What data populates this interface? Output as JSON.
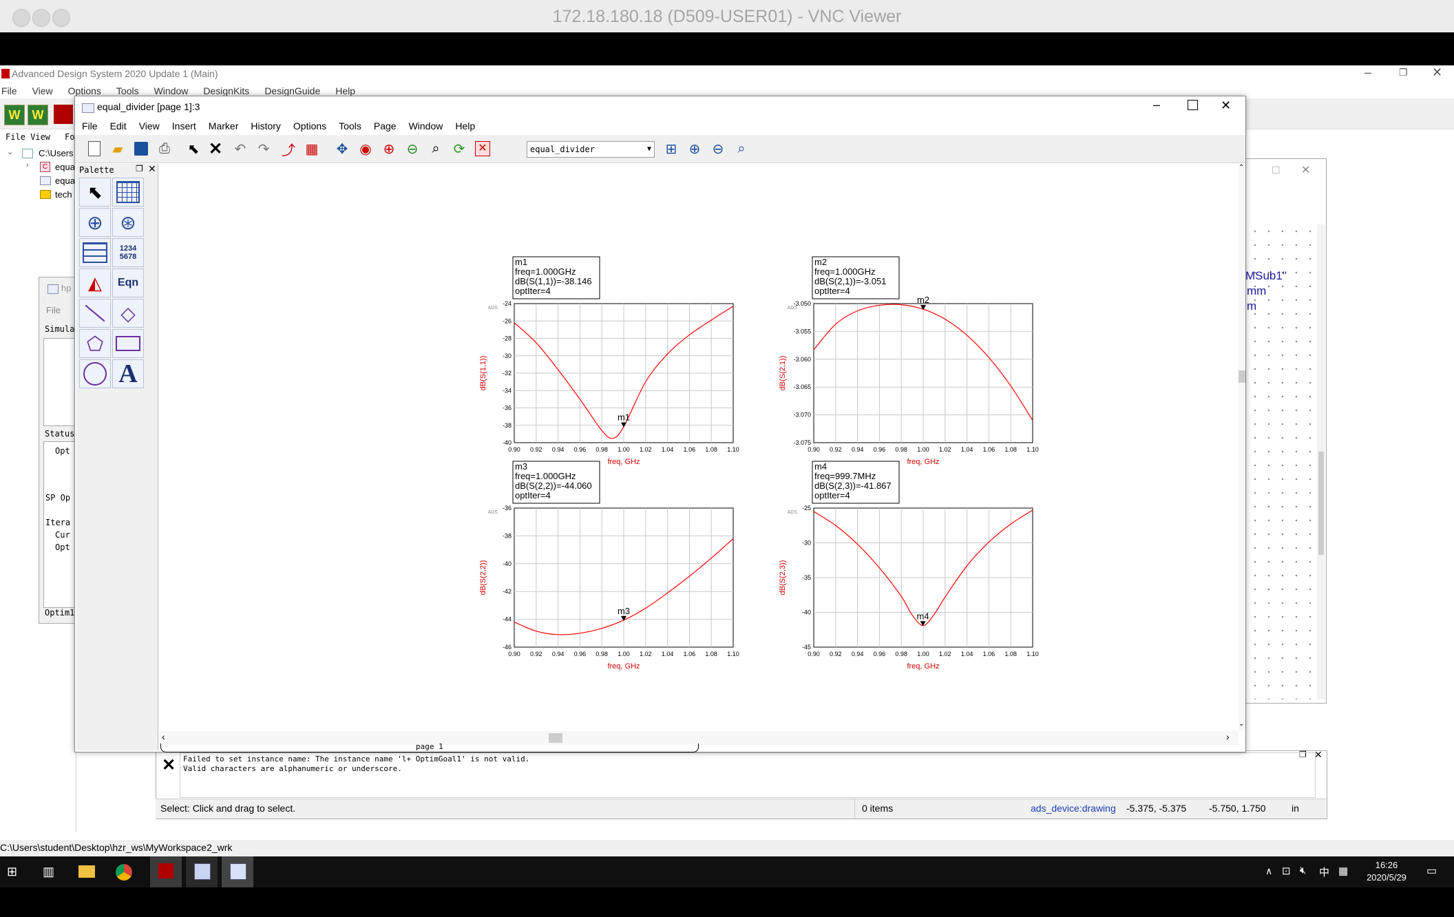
{
  "vnc": {
    "title": "172.18.180.18 (D509-USER01) - VNC Viewer"
  },
  "ads_main": {
    "title": "Advanced Design System 2020 Update 1 (Main)",
    "menu": [
      "File",
      "View",
      "Options",
      "Tools",
      "Window",
      "DesignKits",
      "DesignGuide",
      "Help"
    ],
    "tabs": [
      "File View",
      "Fo"
    ],
    "tree": [
      "C:\\Users",
      "equa",
      "equa",
      "tech"
    ],
    "path": "C:\\Users\\student\\Desktop\\hzr_ws\\MyWorkspace2_wrk"
  },
  "optim_window": {
    "title": "hp",
    "menu": "File",
    "sim_label": "Simula",
    "status_label": "Status",
    "lines": [
      "Opt",
      "SP Op",
      "Itera",
      "Cur",
      "Opt"
    ],
    "footer": "Optim1"
  },
  "layout_window": {
    "text_lines": [
      "=\"MSub1\"",
      "mm",
      "m"
    ]
  },
  "data_display": {
    "title": "equal_divider [page 1]:3",
    "menu": [
      "File",
      "Edit",
      "View",
      "Insert",
      "Marker",
      "History",
      "Options",
      "Tools",
      "Page",
      "Window",
      "Help"
    ],
    "dataset": "equal_divider",
    "palette_title": "Palette",
    "page_tab": "page 1"
  },
  "messages": {
    "line1": "Failed to set instance name: The instance name 'l+ OptimGoal1' is not valid.",
    "line2": "Valid characters are alphanumeric or underscore."
  },
  "statusbar": {
    "hint": "Select: Click and drag to select.",
    "items": "0 items",
    "context": "ads_device:drawing",
    "coord1": "-5.375, -5.375",
    "coord2": "-5.750, 1.750",
    "units": "in"
  },
  "taskbar": {
    "time": "16:26",
    "date": "2020/5/29",
    "ime": "中"
  },
  "colors": {
    "trace": "#ff0000",
    "label": "#d40000",
    "grid": "#c8c8c8"
  },
  "chart_data": [
    {
      "type": "line",
      "ylabel": "dB(S(1,1))",
      "xlabel": "freq, GHz",
      "corner_label": "ADS",
      "x_ticks": [
        "0.90",
        "0.92",
        "0.94",
        "0.96",
        "0.98",
        "1.00",
        "1.02",
        "1.04",
        "1.06",
        "1.08",
        "1.10"
      ],
      "y_ticks": [
        "-24",
        "-26",
        "-28",
        "-30",
        "-32",
        "-34",
        "-36",
        "-38",
        "-40"
      ],
      "xlim": [
        0.9,
        1.1
      ],
      "ylim": [
        -40,
        -24
      ],
      "x": [
        0.9,
        0.92,
        0.94,
        0.96,
        0.98,
        0.99,
        1.0,
        1.02,
        1.04,
        1.06,
        1.08,
        1.1
      ],
      "y": [
        -26.2,
        -28.5,
        -31.6,
        -35.0,
        -38.6,
        -39.5,
        -38.15,
        -33.0,
        -29.8,
        -27.6,
        -25.9,
        -24.3
      ],
      "marker": {
        "name": "m1",
        "x": 1.0,
        "y": -38.146,
        "lines": [
          "m1",
          "freq=1.000GHz",
          "dB(S(1,1))=-38.146",
          "optIter=4"
        ]
      }
    },
    {
      "type": "line",
      "ylabel": "dB(S(2,1))",
      "xlabel": "freq, GHz",
      "corner_label": "ADS",
      "x_ticks": [
        "0.90",
        "0.92",
        "0.94",
        "0.96",
        "0.98",
        "1.00",
        "1.02",
        "1.04",
        "1.06",
        "1.08",
        "1.10"
      ],
      "y_ticks": [
        "-3.050",
        "-3.055",
        "-3.060",
        "-3.065",
        "-3.070",
        "-3.075"
      ],
      "xlim": [
        0.9,
        1.1
      ],
      "ylim": [
        -3.075,
        -3.05
      ],
      "x": [
        0.9,
        0.92,
        0.94,
        0.96,
        0.98,
        1.0,
        1.02,
        1.04,
        1.06,
        1.08,
        1.1
      ],
      "y": [
        -3.0583,
        -3.0537,
        -3.0513,
        -3.0503,
        -3.0502,
        -3.051,
        -3.0528,
        -3.0557,
        -3.0597,
        -3.0648,
        -3.071
      ],
      "marker": {
        "name": "m2",
        "x": 1.0,
        "y": -3.051,
        "lines": [
          "m2",
          "freq=1.000GHz",
          "dB(S(2,1))=-3.051",
          "optIter=4"
        ]
      }
    },
    {
      "type": "line",
      "ylabel": "dB(S(2,2))",
      "xlabel": "freq, GHz",
      "corner_label": "ADS",
      "x_ticks": [
        "0.90",
        "0.92",
        "0.94",
        "0.96",
        "0.98",
        "1.00",
        "1.02",
        "1.04",
        "1.06",
        "1.08",
        "1.10"
      ],
      "y_ticks": [
        "-36",
        "-38",
        "-40",
        "-42",
        "-44",
        "-46"
      ],
      "xlim": [
        0.9,
        1.1
      ],
      "ylim": [
        -46,
        -36
      ],
      "x": [
        0.9,
        0.92,
        0.94,
        0.96,
        0.98,
        1.0,
        1.02,
        1.04,
        1.06,
        1.08,
        1.1
      ],
      "y": [
        -44.2,
        -44.85,
        -45.1,
        -45.0,
        -44.65,
        -44.06,
        -43.2,
        -42.1,
        -40.9,
        -39.6,
        -38.2
      ],
      "marker": {
        "name": "m3",
        "x": 1.0,
        "y": -44.06,
        "lines": [
          "m3",
          "freq=1.000GHz",
          "dB(S(2,2))=-44.060",
          "optIter=4"
        ]
      }
    },
    {
      "type": "line",
      "ylabel": "dB(S(2,3))",
      "xlabel": "freq, GHz",
      "corner_label": "ADS",
      "x_ticks": [
        "0.90",
        "0.92",
        "0.94",
        "0.96",
        "0.98",
        "1.00",
        "1.02",
        "1.04",
        "1.06",
        "1.08",
        "1.10"
      ],
      "y_ticks": [
        "-25",
        "-30",
        "-35",
        "-40",
        "-45"
      ],
      "xlim": [
        0.9,
        1.1
      ],
      "ylim": [
        -45,
        -25
      ],
      "x": [
        0.9,
        0.92,
        0.94,
        0.96,
        0.98,
        0.99,
        1.0,
        1.01,
        1.02,
        1.04,
        1.06,
        1.08,
        1.1
      ],
      "y": [
        -25.5,
        -27.5,
        -30.2,
        -33.6,
        -37.7,
        -40.4,
        -41.9,
        -40.3,
        -37.8,
        -33.3,
        -29.9,
        -27.3,
        -25.3
      ],
      "marker": {
        "name": "m4",
        "x": 0.9997,
        "y": -41.867,
        "lines": [
          "m4",
          "freq=999.7MHz",
          "dB(S(2,3))=-41.867",
          "optIter=4"
        ]
      }
    }
  ]
}
